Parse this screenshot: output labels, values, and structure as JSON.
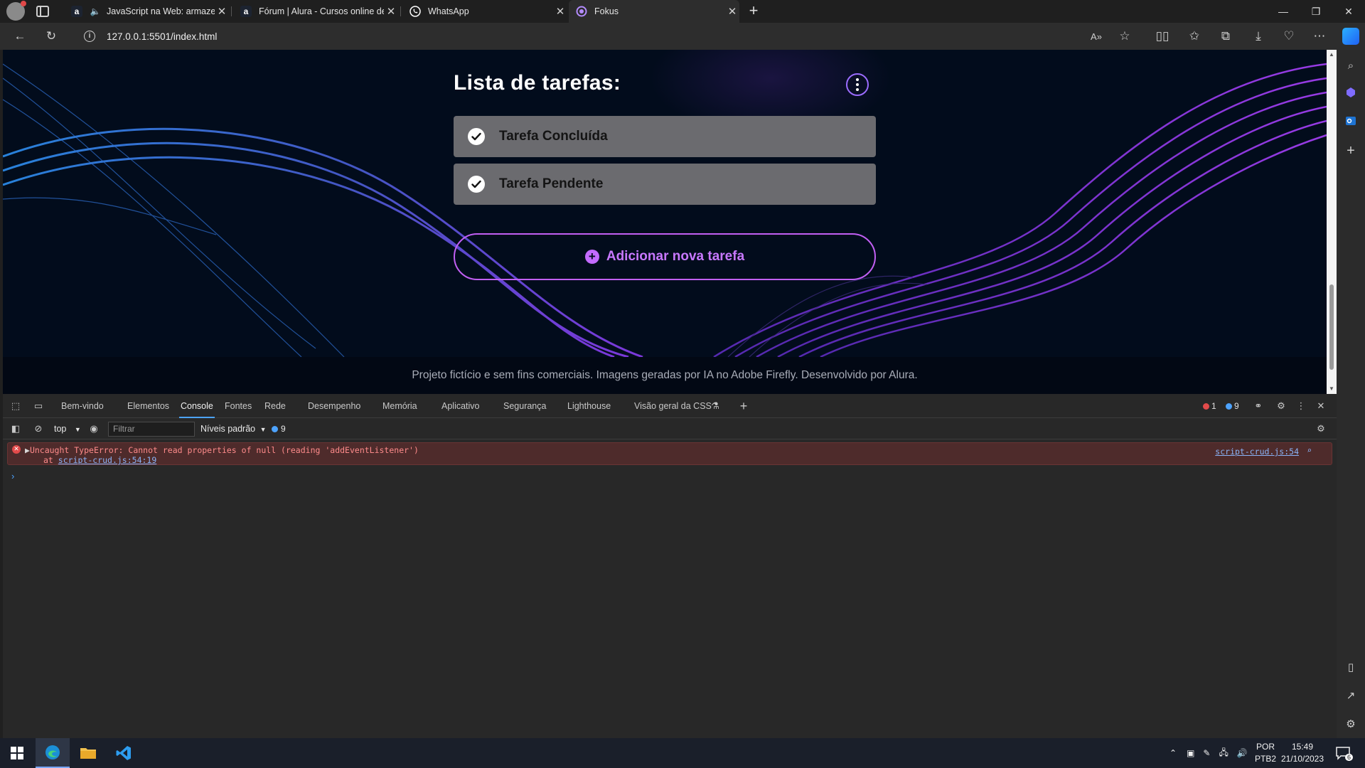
{
  "browser": {
    "tabs": [
      {
        "title": "JavaScript na Web: armazen",
        "icon": "alura-icon"
      },
      {
        "title": "Fórum | Alura - Cursos online de",
        "icon": "alura-icon"
      },
      {
        "title": "WhatsApp",
        "icon": "whatsapp-icon"
      },
      {
        "title": "Fokus",
        "icon": "fokus-icon",
        "active": true
      }
    ],
    "url": "127.0.0.1:5501/index.html"
  },
  "page": {
    "heading": "Lista de tarefas:",
    "tasks": [
      {
        "label": "Tarefa Concluída",
        "checked": true
      },
      {
        "label": "Tarefa Pendente",
        "checked": true
      }
    ],
    "add_button": "Adicionar nova tarefa",
    "footer": "Projeto fictício e sem fins comerciais. Imagens geradas por IA no Adobe Firefly. Desenvolvido por Alura."
  },
  "devtools": {
    "tabs": [
      "Bem-vindo",
      "Elementos",
      "Console",
      "Fontes",
      "Rede",
      "Desempenho",
      "Memória",
      "Aplicativo",
      "Segurança",
      "Lighthouse",
      "Visão geral da CSS"
    ],
    "active_tab": "Console",
    "error_count": "1",
    "issue_count": "9",
    "context": "top",
    "filter_placeholder": "Filtrar",
    "levels": "Níveis padrão",
    "console_issues": "9",
    "error": {
      "message": "Uncaught TypeError: Cannot read properties of null (reading 'addEventListener')",
      "at_prefix": "at",
      "at_link": "script-crud.js:54:19",
      "source": "script-crud.js:54"
    }
  },
  "taskbar": {
    "lang": "POR",
    "layout": "PTB2",
    "time": "15:49",
    "date": "21/10/2023",
    "notifications": "6"
  },
  "colors": {
    "page_bg": "#020c1c",
    "accent_purple": "#c15ff3",
    "task_bg": "#6b6b6f",
    "devtools_error_bg": "#4e2b2b"
  }
}
